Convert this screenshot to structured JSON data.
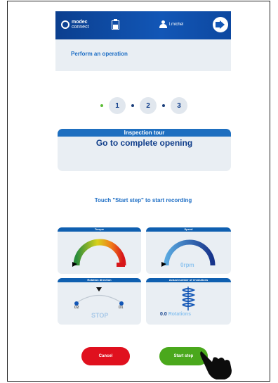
{
  "header": {
    "logo_name": "modec",
    "logo_sub": "connect",
    "user": "l.michel",
    "battery_level": "low"
  },
  "page": {
    "title": "Perform an operation"
  },
  "steps": [
    "1",
    "2",
    "3"
  ],
  "card": {
    "heading": "Inspection tour",
    "body": "Go to complete opening"
  },
  "hint": "Touch \"Start step\" to start recording",
  "gauges": {
    "torque": {
      "label": "Torque"
    },
    "speed": {
      "label": "Speed",
      "value": "0",
      "unit": "rpm"
    },
    "rotation": {
      "label": "Rotation direction",
      "left": "D2",
      "right": "D1",
      "status": "STOP"
    },
    "revolutions": {
      "label": "Actual number of revolutions",
      "value": "0.0",
      "unit": "Rotations"
    }
  },
  "buttons": {
    "cancel": "Cancel",
    "start": "Start step"
  },
  "colors": {
    "header": "#1256b6",
    "accent": "#1f6fc5",
    "cancel": "#e0101e",
    "start": "#4aa81c"
  }
}
